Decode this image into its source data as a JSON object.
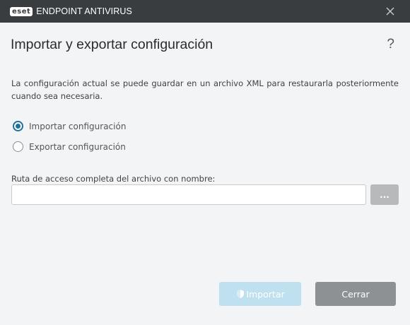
{
  "window": {
    "logo_text": "eset",
    "app_name": "ENDPOINT ANTIVIRUS"
  },
  "header": {
    "title": "Importar y exportar configuración",
    "help_glyph": "?"
  },
  "description": "La configuración actual se puede guardar en un archivo XML para restaurarla posteriormente cuando sea necesaria.",
  "options": [
    {
      "label": "Importar configuración",
      "selected": true
    },
    {
      "label": "Exportar configuración",
      "selected": false
    }
  ],
  "path": {
    "label": "Ruta de acceso completa del archivo con nombre:",
    "value": "",
    "placeholder": "",
    "browse_label": "..."
  },
  "buttons": {
    "import_label": "Importar",
    "import_icon": "shield-icon",
    "close_label": "Cerrar"
  },
  "colors": {
    "titlebar": "#3a3d40",
    "accent": "#1f6f9a",
    "import_disabled": "#bfe0ef",
    "close_button": "#8e9194"
  }
}
